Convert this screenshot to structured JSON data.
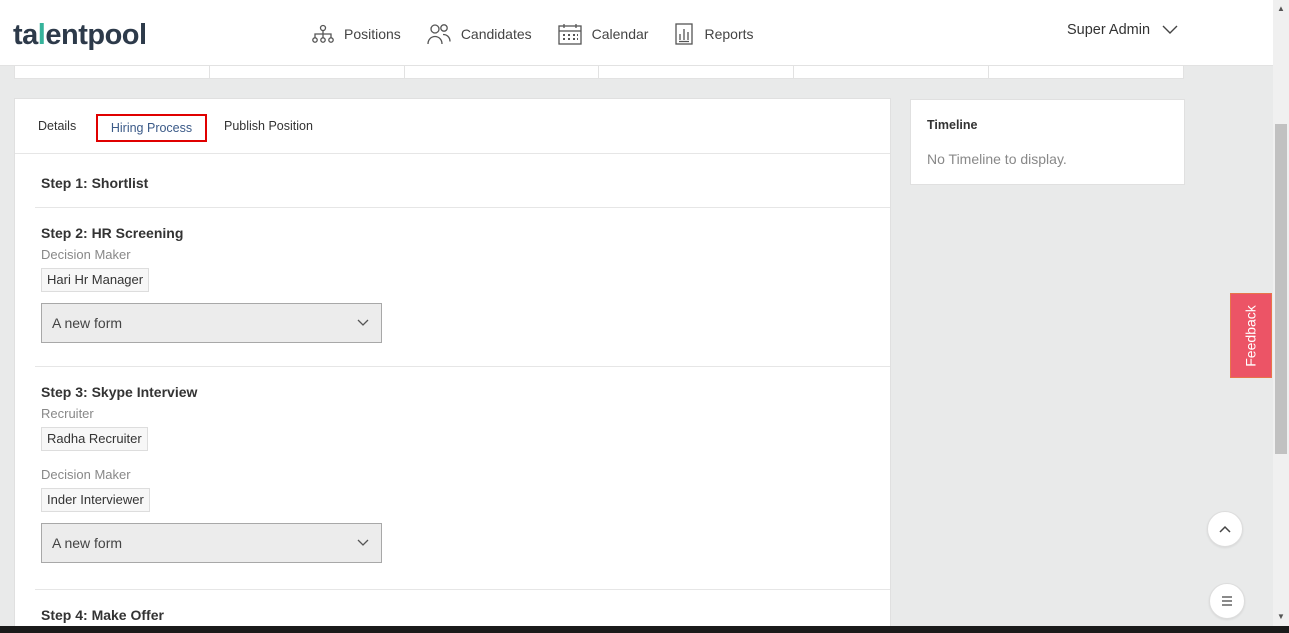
{
  "header": {
    "logo": {
      "part1": "ta",
      "accent": "l",
      "part2": "entpool"
    },
    "nav": [
      {
        "label": "Positions",
        "icon": "hierarchy-icon"
      },
      {
        "label": "Candidates",
        "icon": "users-icon"
      },
      {
        "label": "Calendar",
        "icon": "calendar-icon"
      },
      {
        "label": "Reports",
        "icon": "report-icon"
      }
    ],
    "user": "Super Admin"
  },
  "tabs": [
    "Details",
    "Hiring Process",
    "Publish Position"
  ],
  "steps": {
    "s1": {
      "title": "Step 1: Shortlist"
    },
    "s2": {
      "title": "Step 2: HR Screening",
      "role1": "Decision Maker",
      "person1": "Hari Hr Manager",
      "form": "A new form"
    },
    "s3": {
      "title": "Step 3: Skype Interview",
      "role1": "Recruiter",
      "person1": "Radha Recruiter",
      "role2": "Decision Maker",
      "person2": "Inder Interviewer",
      "form": "A new form"
    },
    "s4": {
      "title": "Step 4: Make Offer"
    }
  },
  "timeline": {
    "title": "Timeline",
    "empty": "No Timeline to display."
  },
  "feedback": "Feedback",
  "colors": {
    "accent": "#36b39b",
    "highlight": "#e00000",
    "feedback": "#ec5466"
  }
}
